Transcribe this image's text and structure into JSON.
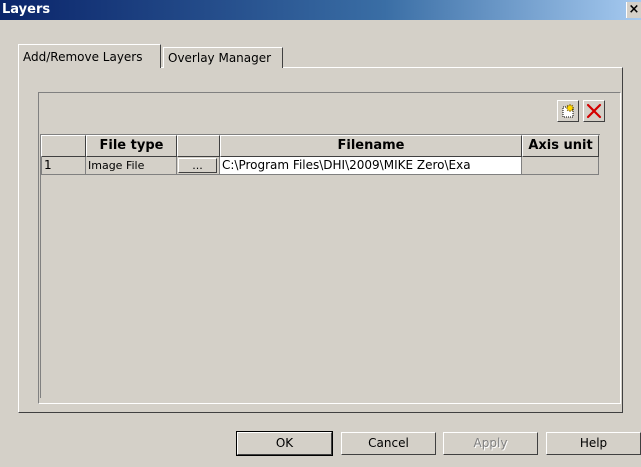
{
  "window": {
    "title": "Layers",
    "close_glyph": "×"
  },
  "tabs": [
    {
      "label": "Add/Remove Layers",
      "active": true
    },
    {
      "label": "Overlay Manager",
      "active": false
    }
  ],
  "toolbar": {
    "add_icon": "new-layer-icon",
    "delete_icon": "delete-x-icon",
    "delete_color": "#d40000"
  },
  "grid": {
    "columns": [
      "",
      "File type",
      "",
      "Filename",
      "Axis unit"
    ],
    "rows": [
      {
        "index": "1",
        "file_type": "Image File",
        "browse": "...",
        "filename": "C:\\Program Files\\DHI\\2009\\MIKE Zero\\Exa",
        "axis_unit": ""
      }
    ]
  },
  "buttons": {
    "ok": "OK",
    "cancel": "Cancel",
    "apply": "Apply",
    "help": "Help"
  },
  "colors": {
    "face": "#d4d0c8",
    "titlebar_start": "#0a246a"
  }
}
